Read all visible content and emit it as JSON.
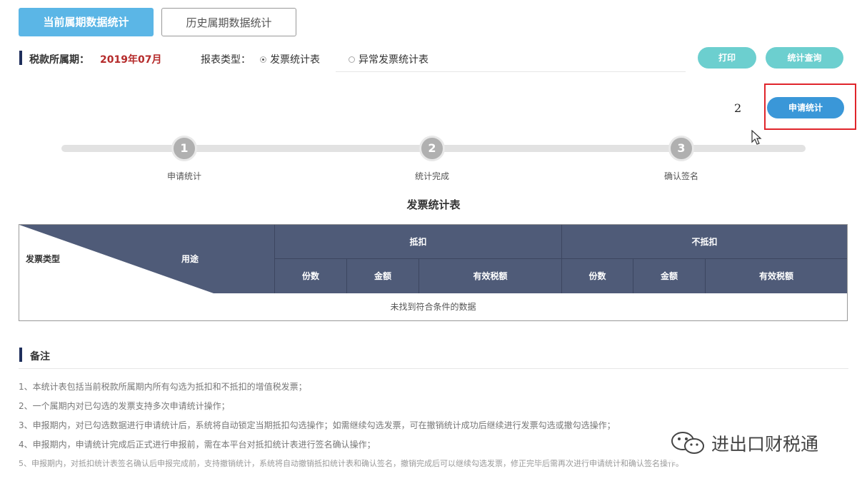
{
  "tabs": {
    "current": "当前属期数据统计",
    "history": "历史属期数据统计"
  },
  "period": {
    "label": "税款所属期：",
    "value": "2019年07月"
  },
  "report_type": {
    "label": "报表类型：",
    "options": [
      "发票统计表",
      "异常发票统计表"
    ],
    "selected": "发票统计表"
  },
  "actions": {
    "print": "打印",
    "query": "统计查询",
    "apply": "申请统计"
  },
  "annotation_number": "2",
  "steps": [
    {
      "num": "1",
      "label": "申请统计"
    },
    {
      "num": "2",
      "label": "统计完成"
    },
    {
      "num": "3",
      "label": "确认签名"
    }
  ],
  "table": {
    "title": "发票统计表",
    "corner_left": "发票类型",
    "corner_right": "用途",
    "groups": [
      "抵扣",
      "不抵扣"
    ],
    "subheaders": [
      "份数",
      "金额",
      "有效税额",
      "份数",
      "金额",
      "有效税额"
    ],
    "empty_text": "未找到符合条件的数据"
  },
  "notes": {
    "title": "备注",
    "items": [
      "1、本统计表包括当前税款所属期内所有勾选为抵扣和不抵扣的增值税发票；",
      "2、一个属期内对已勾选的发票支持多次申请统计操作；",
      "3、申报期内，对已勾选数据进行申请统计后，系统将自动锁定当期抵扣勾选操作；如需继续勾选发票，可在撤销统计成功后继续进行发票勾选或撤勾选操作；",
      "4、申报期内，申请统计完成后正式进行申报前，需在本平台对抵扣统计表进行签名确认操作；",
      "5、申报期内，对抵扣统计表签名确认后申报完成前，支持撤销统计，系统将自动撤销抵扣统计表和确认签名，撤销完成后可以继续勾选发票，修正完毕后需再次进行申请统计和确认签名操作。"
    ]
  },
  "watermark": "进出口财税通",
  "colors": {
    "tab_active": "#5bb6e6",
    "period_value": "#b52b2b",
    "header_bg": "#4f5b78",
    "teal_button": "#6ccfcf",
    "blue_button": "#3a97d8",
    "highlight_box": "#e0252b"
  }
}
